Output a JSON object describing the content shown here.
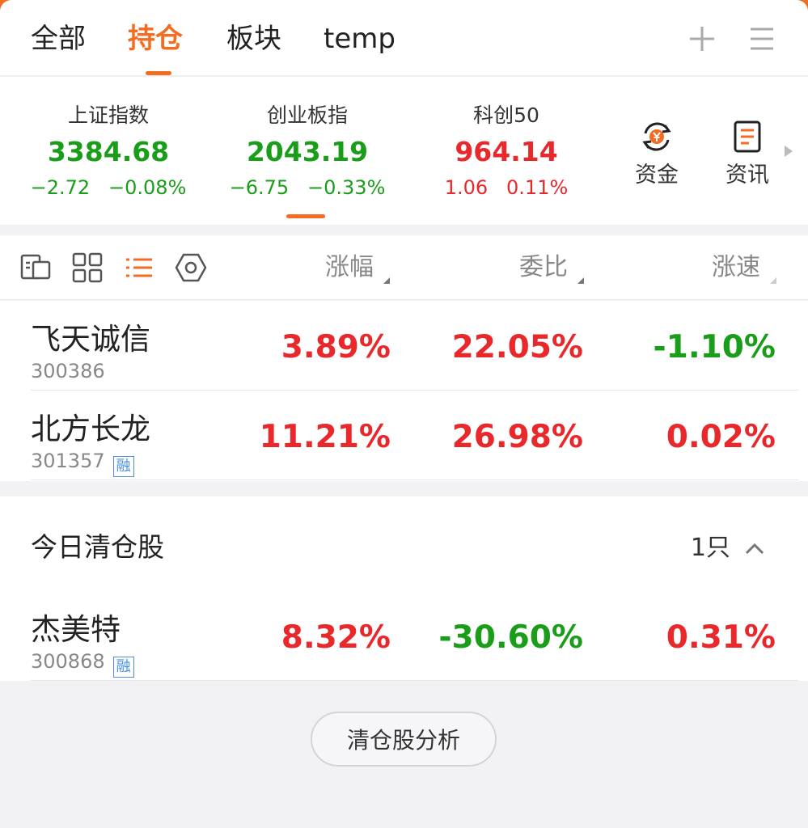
{
  "tabs": [
    {
      "label": "全部",
      "active": false
    },
    {
      "label": "持仓",
      "active": true
    },
    {
      "label": "板块",
      "active": false
    },
    {
      "label": "temp",
      "active": false
    }
  ],
  "toolbar_icons": [
    "plus-icon",
    "menu-icon"
  ],
  "indices": [
    {
      "name": "上证指数",
      "value": "3384.68",
      "change": "−2.72   −0.08%",
      "trend": "down"
    },
    {
      "name": "创业板指",
      "value": "2043.19",
      "change": "−6.75   −0.33%",
      "trend": "down"
    },
    {
      "name": "科创50",
      "value": "964.14",
      "change": "1.06   0.11%",
      "trend": "up"
    }
  ],
  "quick_links": [
    {
      "label": "资金",
      "icon": "yuan-cycle-icon"
    },
    {
      "label": "资讯",
      "icon": "news-doc-icon"
    }
  ],
  "columns": {
    "change": "涨幅",
    "bid_ratio": "委比",
    "speed": "涨速"
  },
  "holdings": [
    {
      "name": "飞天诚信",
      "code": "300386",
      "margin_badge": "",
      "change": "3.89%",
      "bid_ratio": "22.05%",
      "speed": "-1.10%",
      "change_color": "red",
      "bid_color": "red",
      "speed_color": "green"
    },
    {
      "name": "北方长龙",
      "code": "301357",
      "margin_badge": "融",
      "change": "11.21%",
      "bid_ratio": "26.98%",
      "speed": "0.02%",
      "change_color": "red",
      "bid_color": "red",
      "speed_color": "red"
    }
  ],
  "cleared": {
    "title": "今日清仓股",
    "count": "1只",
    "stocks": [
      {
        "name": "杰美特",
        "code": "300868",
        "margin_badge": "融",
        "change": "8.32%",
        "bid_ratio": "-30.60%",
        "speed": "0.31%",
        "change_color": "red",
        "bid_color": "green",
        "speed_color": "red"
      }
    ],
    "analysis_button": "清仓股分析"
  },
  "colors": {
    "accent": "#f36c21",
    "up": "#e8282a",
    "down": "#1a9e1a",
    "margin_badge": "#4a8fe0"
  }
}
